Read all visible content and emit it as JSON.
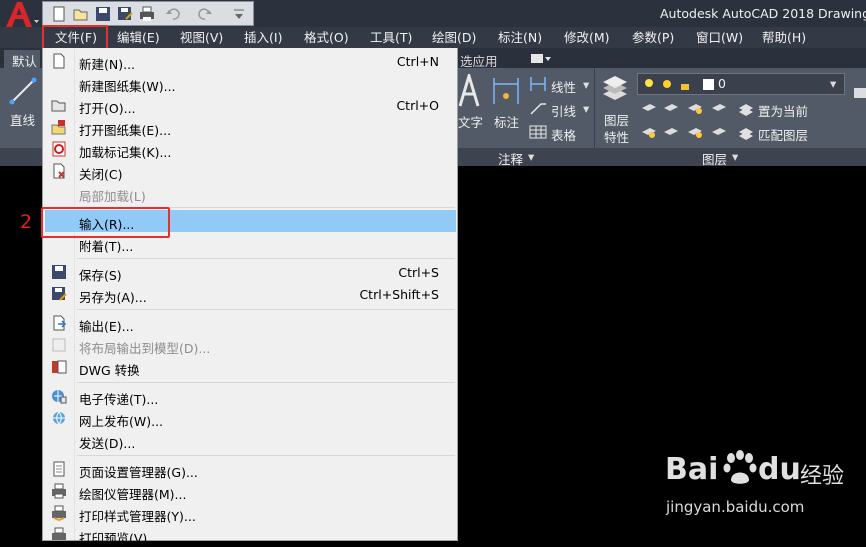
{
  "title_bar": {
    "app_title": "Autodesk AutoCAD 2018   Drawing",
    "quick_access": [
      "new-icon",
      "open-icon",
      "save-icon",
      "save-as-icon",
      "plot-icon",
      "undo-icon",
      "redo-icon",
      "customize-icon"
    ]
  },
  "menubar": {
    "items": [
      "文件(F)",
      "编辑(E)",
      "视图(V)",
      "插入(I)",
      "格式(O)",
      "工具(T)",
      "绘图(D)",
      "标注(N)",
      "修改(M)",
      "参数(P)",
      "窗口(W)",
      "帮助(H)"
    ]
  },
  "ribbon": {
    "tab_default": "默认",
    "tab_selected_apps": "选应用",
    "line_label": "直线",
    "text_label": "文字",
    "dim_label": "标注",
    "linetype_label": "线性",
    "leader_label": "引线",
    "table_label": "表格",
    "annotation_panel": "注释",
    "layer_props_label": "图层\n特性",
    "layer_props_line1": "图层",
    "layer_props_line2": "特性",
    "layer_combo_value": "0",
    "set_current_label": "置为当前",
    "match_layer_label": "匹配图层",
    "layers_panel": "图层"
  },
  "file_menu": {
    "items": [
      {
        "label": "新建(N)...",
        "shortcut": "Ctrl+N"
      },
      {
        "label": "新建图纸集(W)...",
        "shortcut": ""
      },
      {
        "label": "打开(O)...",
        "shortcut": "Ctrl+O"
      },
      {
        "label": "打开图纸集(E)...",
        "shortcut": ""
      },
      {
        "label": "加载标记集(K)...",
        "shortcut": ""
      },
      {
        "label": "关闭(C)",
        "shortcut": ""
      },
      {
        "label": "局部加载(L)",
        "shortcut": ""
      },
      {
        "label": "输入(R)...",
        "shortcut": ""
      },
      {
        "label": "附着(T)...",
        "shortcut": ""
      },
      {
        "label": "保存(S)",
        "shortcut": "Ctrl+S"
      },
      {
        "label": "另存为(A)...",
        "shortcut": "Ctrl+Shift+S"
      },
      {
        "label": "输出(E)...",
        "shortcut": ""
      },
      {
        "label": "将布局输出到模型(D)...",
        "shortcut": ""
      },
      {
        "label": "DWG 转换",
        "shortcut": ""
      },
      {
        "label": "电子传递(T)...",
        "shortcut": ""
      },
      {
        "label": "网上发布(W)...",
        "shortcut": ""
      },
      {
        "label": "发送(D)...",
        "shortcut": ""
      },
      {
        "label": "页面设置管理器(G)...",
        "shortcut": ""
      },
      {
        "label": "绘图仪管理器(M)...",
        "shortcut": ""
      },
      {
        "label": "打印样式管理器(Y)...",
        "shortcut": ""
      },
      {
        "label": "打印预览(V)",
        "shortcut": ""
      }
    ]
  },
  "annotation": {
    "step_number": "2"
  },
  "watermark": {
    "brand_left": "Bai",
    "brand_right": "du",
    "brand_cn": "经验",
    "url": "jingyan.baidu.com"
  },
  "colors": {
    "highlight": "#91c9f7",
    "annotation_red": "#e53030",
    "ribbon_bg": "#515a66"
  }
}
